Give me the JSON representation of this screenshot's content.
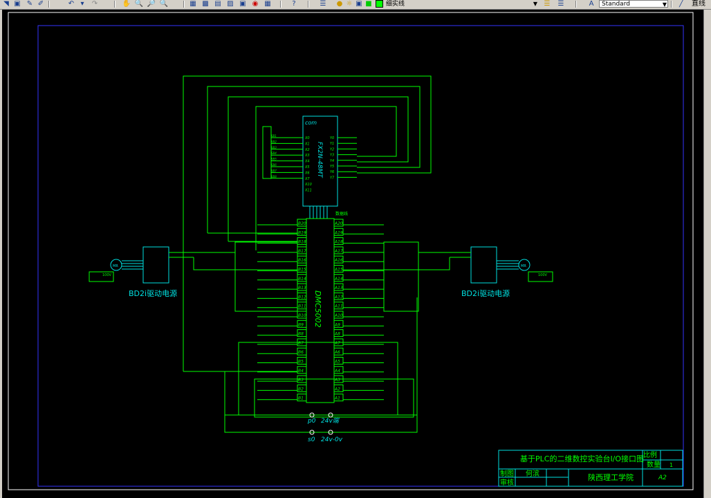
{
  "toolbar": {
    "layer_color_label": "细实线",
    "style_value": "Standard",
    "line_tool_label": "直线"
  },
  "drawing": {
    "plc_com": "com",
    "plc_model": "FX2N-48MT",
    "plc_x_inputs": [
      "X0",
      "X1",
      "X2",
      "X3",
      "X4",
      "X5",
      "X6",
      "X7",
      "X10",
      "X11"
    ],
    "plc_y_outputs": [
      "Y0",
      "Y1",
      "Y2",
      "Y3",
      "Y4",
      "Y5",
      "Y6",
      "Y7"
    ],
    "data_line": "数据线",
    "card_model": "DMC5002",
    "card_left_pins": [
      "B20",
      "B19",
      "B18",
      "B17",
      "B16",
      "B15",
      "B14",
      "B13",
      "B12",
      "B11",
      "B10",
      "B9",
      "B8",
      "B7",
      "B6",
      "B5",
      "B4",
      "B3",
      "B2",
      "B1"
    ],
    "card_right_pins": [
      "A20",
      "A19",
      "A18",
      "A17",
      "A16",
      "A15",
      "A14",
      "A13",
      "A12",
      "A11",
      "A10",
      "A9",
      "A8",
      "A7",
      "A6",
      "A5",
      "A4",
      "A3",
      "A2",
      "A1"
    ],
    "left_driver_label": "BD2i驱动电源",
    "right_driver_label": "BD2i驱动电源",
    "motor_label": "MR",
    "supply_label": "100V",
    "terminal_p0": "p0",
    "terminal_s0": "s0",
    "terminal_24v": "24v端",
    "terminal_24v0": "24v-0v",
    "title_main": "基于PLC的二维数控实验台I/O接口图",
    "title_ratio_label": "比例",
    "title_qty_label": "数量",
    "title_qty_value": "1",
    "title_drawn_label": "制图",
    "title_drawn_value": "何滨",
    "title_check_label": "审核",
    "title_school": "陕西理工学院",
    "title_sheet": "A2"
  }
}
